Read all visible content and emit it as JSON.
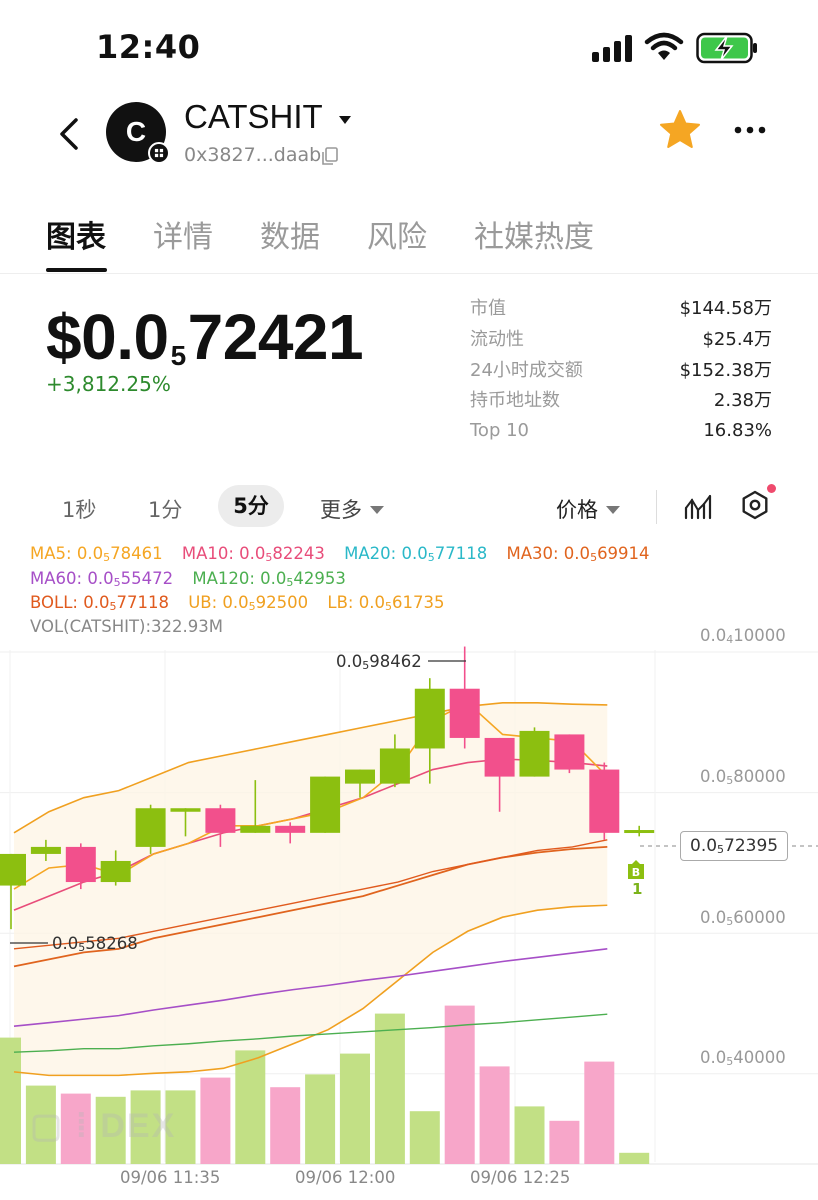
{
  "status_bar": {
    "time": "12:40"
  },
  "header": {
    "avatar_letter": "C",
    "token_name": "CATSHIT",
    "address": "0x3827...daab"
  },
  "tabs": [
    {
      "label": "图表",
      "active": true
    },
    {
      "label": "详情"
    },
    {
      "label": "数据"
    },
    {
      "label": "风险"
    },
    {
      "label": "社媒热度"
    }
  ],
  "price": {
    "prefix": "$0.0",
    "sub_zeros": "5",
    "digits": "72421",
    "change": "+3,812.25%"
  },
  "stats": [
    {
      "label": "市值",
      "value": "$144.58万"
    },
    {
      "label": "流动性",
      "value": "$25.4万"
    },
    {
      "label": "24小时成交额",
      "value": "$152.38万"
    },
    {
      "label": "持币地址数",
      "value": "2.38万"
    },
    {
      "label": "Top 10",
      "value": "16.83%"
    }
  ],
  "toolbar": {
    "tf_1s": "1秒",
    "tf_1m": "1分",
    "tf_5m": "5分",
    "more": "更多",
    "price_type": "价格"
  },
  "legends": {
    "ma5": {
      "label": "MA5: 0.0",
      "sub": "5",
      "rest": "78461",
      "color": "#f5a623"
    },
    "ma10": {
      "label": "MA10: 0.0",
      "sub": "5",
      "rest": "82243",
      "color": "#e84d7a"
    },
    "ma20": {
      "label": "MA20: 0.0",
      "sub": "5",
      "rest": "77118",
      "color": "#2ab8c8"
    },
    "ma30": {
      "label": "MA30: 0.0",
      "sub": "5",
      "rest": "69914",
      "color": "#e0641e"
    },
    "ma60": {
      "label": "MA60: 0.0",
      "sub": "5",
      "rest": "55472",
      "color": "#a64fc7"
    },
    "ma120": {
      "label": "MA120: 0.0",
      "sub": "5",
      "rest": "42953",
      "color": "#4caf50"
    },
    "boll": {
      "label": "BOLL: 0.0",
      "sub": "5",
      "rest": "77118",
      "color": "#e05a1e"
    },
    "ub": {
      "label": "UB: 0.0",
      "sub": "5",
      "rest": "92500",
      "color": "#f0a020"
    },
    "lb": {
      "label": "LB: 0.0",
      "sub": "5",
      "rest": "61735",
      "color": "#f0a020"
    },
    "vol": "VOL(CATSHIT):322.93M"
  },
  "axis": {
    "y_labels": [
      {
        "prefix": "0.0",
        "sub": "4",
        "rest": "10000"
      },
      {
        "prefix": "0.0",
        "sub": "5",
        "rest": "80000"
      },
      {
        "prefix": "0.0",
        "sub": "5",
        "rest": "60000"
      },
      {
        "prefix": "0.0",
        "sub": "5",
        "rest": "40000"
      }
    ],
    "current_price": {
      "prefix": "0.0",
      "sub": "5",
      "rest": "72395"
    },
    "high_label": {
      "prefix": "0.0",
      "sub": "5",
      "rest": "98462"
    },
    "low_label": {
      "prefix": "0.0",
      "sub": "5",
      "rest": "58268"
    },
    "time_labels": [
      "09/06 11:35",
      "09/06 12:00",
      "09/06 12:25"
    ]
  },
  "buy_marker": {
    "letter": "B",
    "count": "1"
  },
  "watermark": "DEX",
  "colors": {
    "up": "#8cbf10",
    "down": "#f2508c",
    "up_vol": "#c2e085",
    "down_vol": "#f7a6c9",
    "star": "#f5a623"
  },
  "chart_data": {
    "type": "candlestick",
    "unit_note_scale": "price ×1e-6",
    "x": [
      "11:15",
      "11:20",
      "11:25",
      "11:30",
      "11:35",
      "11:40",
      "11:45",
      "11:50",
      "11:55",
      "12:00",
      "12:05",
      "12:10",
      "12:15",
      "12:20",
      "12:25",
      "12:30",
      "12:35",
      "12:40"
    ],
    "candles": [
      {
        "o": 64.5,
        "h": 68.0,
        "l": 58.3,
        "c": 69.0,
        "up": true
      },
      {
        "o": 69.0,
        "h": 71.0,
        "l": 68.0,
        "c": 70.0,
        "up": true
      },
      {
        "o": 70.0,
        "h": 70.5,
        "l": 64.0,
        "c": 65.0,
        "up": false
      },
      {
        "o": 65.0,
        "h": 69.5,
        "l": 64.5,
        "c": 68.0,
        "up": true
      },
      {
        "o": 70.0,
        "h": 76.0,
        "l": 69.0,
        "c": 75.5,
        "up": true
      },
      {
        "o": 75.5,
        "h": 75.5,
        "l": 71.5,
        "c": 75.0,
        "up": true
      },
      {
        "o": 75.5,
        "h": 76.0,
        "l": 70.0,
        "c": 72.0,
        "up": false
      },
      {
        "o": 72.0,
        "h": 79.5,
        "l": 72.0,
        "c": 73.0,
        "up": true
      },
      {
        "o": 73.0,
        "h": 73.5,
        "l": 70.5,
        "c": 72.0,
        "up": false
      },
      {
        "o": 72.0,
        "h": 80.0,
        "l": 72.0,
        "c": 80.0,
        "up": true
      },
      {
        "o": 79.0,
        "h": 81.0,
        "l": 77.0,
        "c": 81.0,
        "up": true
      },
      {
        "o": 79.0,
        "h": 86.0,
        "l": 78.5,
        "c": 84.0,
        "up": true
      },
      {
        "o": 84.0,
        "h": 94.0,
        "l": 79.0,
        "c": 92.5,
        "up": true
      },
      {
        "o": 92.5,
        "h": 98.5,
        "l": 84.0,
        "c": 85.5,
        "up": false
      },
      {
        "o": 85.5,
        "h": 85.5,
        "l": 75.0,
        "c": 80.0,
        "up": false
      },
      {
        "o": 80.0,
        "h": 87.0,
        "l": 80.0,
        "c": 86.5,
        "up": true
      },
      {
        "o": 86.0,
        "h": 86.0,
        "l": 80.5,
        "c": 81.0,
        "up": false
      },
      {
        "o": 81.0,
        "h": 82.0,
        "l": 71.0,
        "c": 72.0,
        "up": false
      },
      {
        "o": 72.0,
        "h": 73.0,
        "l": 71.5,
        "c": 72.4,
        "up": true
      }
    ],
    "volume_rel": [
      0.79,
      0.49,
      0.44,
      0.42,
      0.46,
      0.46,
      0.54,
      0.71,
      0.48,
      0.56,
      0.69,
      0.94,
      0.33,
      0.99,
      0.61,
      0.36,
      0.27,
      0.64,
      0.07
    ],
    "y_axis": {
      "min": 35,
      "max": 105,
      "ticks": [
        100,
        80,
        60,
        40
      ]
    }
  }
}
